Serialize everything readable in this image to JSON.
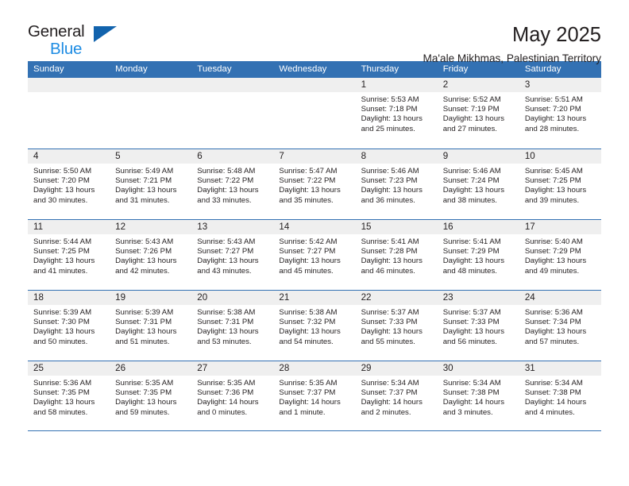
{
  "logo": {
    "word_top": "General",
    "word_bottom": "Blue",
    "triangle_color": "#1263ad",
    "blue_text_color": "#1e8ce3"
  },
  "header": {
    "title": "May 2025",
    "subtitle": "Ma'ale Mikhmas, Palestinian Territory"
  },
  "theme": {
    "accent": "#3371b3",
    "daynum_band": "#efefef",
    "text": "#231f20"
  },
  "weekdays": [
    "Sunday",
    "Monday",
    "Tuesday",
    "Wednesday",
    "Thursday",
    "Friday",
    "Saturday"
  ],
  "weeks": [
    [
      {
        "date": "",
        "sunrise": "",
        "sunset": "",
        "daylight": ""
      },
      {
        "date": "",
        "sunrise": "",
        "sunset": "",
        "daylight": ""
      },
      {
        "date": "",
        "sunrise": "",
        "sunset": "",
        "daylight": ""
      },
      {
        "date": "",
        "sunrise": "",
        "sunset": "",
        "daylight": ""
      },
      {
        "date": "1",
        "sunrise": "Sunrise: 5:53 AM",
        "sunset": "Sunset: 7:18 PM",
        "daylight": "Daylight: 13 hours and 25 minutes."
      },
      {
        "date": "2",
        "sunrise": "Sunrise: 5:52 AM",
        "sunset": "Sunset: 7:19 PM",
        "daylight": "Daylight: 13 hours and 27 minutes."
      },
      {
        "date": "3",
        "sunrise": "Sunrise: 5:51 AM",
        "sunset": "Sunset: 7:20 PM",
        "daylight": "Daylight: 13 hours and 28 minutes."
      }
    ],
    [
      {
        "date": "4",
        "sunrise": "Sunrise: 5:50 AM",
        "sunset": "Sunset: 7:20 PM",
        "daylight": "Daylight: 13 hours and 30 minutes."
      },
      {
        "date": "5",
        "sunrise": "Sunrise: 5:49 AM",
        "sunset": "Sunset: 7:21 PM",
        "daylight": "Daylight: 13 hours and 31 minutes."
      },
      {
        "date": "6",
        "sunrise": "Sunrise: 5:48 AM",
        "sunset": "Sunset: 7:22 PM",
        "daylight": "Daylight: 13 hours and 33 minutes."
      },
      {
        "date": "7",
        "sunrise": "Sunrise: 5:47 AM",
        "sunset": "Sunset: 7:22 PM",
        "daylight": "Daylight: 13 hours and 35 minutes."
      },
      {
        "date": "8",
        "sunrise": "Sunrise: 5:46 AM",
        "sunset": "Sunset: 7:23 PM",
        "daylight": "Daylight: 13 hours and 36 minutes."
      },
      {
        "date": "9",
        "sunrise": "Sunrise: 5:46 AM",
        "sunset": "Sunset: 7:24 PM",
        "daylight": "Daylight: 13 hours and 38 minutes."
      },
      {
        "date": "10",
        "sunrise": "Sunrise: 5:45 AM",
        "sunset": "Sunset: 7:25 PM",
        "daylight": "Daylight: 13 hours and 39 minutes."
      }
    ],
    [
      {
        "date": "11",
        "sunrise": "Sunrise: 5:44 AM",
        "sunset": "Sunset: 7:25 PM",
        "daylight": "Daylight: 13 hours and 41 minutes."
      },
      {
        "date": "12",
        "sunrise": "Sunrise: 5:43 AM",
        "sunset": "Sunset: 7:26 PM",
        "daylight": "Daylight: 13 hours and 42 minutes."
      },
      {
        "date": "13",
        "sunrise": "Sunrise: 5:43 AM",
        "sunset": "Sunset: 7:27 PM",
        "daylight": "Daylight: 13 hours and 43 minutes."
      },
      {
        "date": "14",
        "sunrise": "Sunrise: 5:42 AM",
        "sunset": "Sunset: 7:27 PM",
        "daylight": "Daylight: 13 hours and 45 minutes."
      },
      {
        "date": "15",
        "sunrise": "Sunrise: 5:41 AM",
        "sunset": "Sunset: 7:28 PM",
        "daylight": "Daylight: 13 hours and 46 minutes."
      },
      {
        "date": "16",
        "sunrise": "Sunrise: 5:41 AM",
        "sunset": "Sunset: 7:29 PM",
        "daylight": "Daylight: 13 hours and 48 minutes."
      },
      {
        "date": "17",
        "sunrise": "Sunrise: 5:40 AM",
        "sunset": "Sunset: 7:29 PM",
        "daylight": "Daylight: 13 hours and 49 minutes."
      }
    ],
    [
      {
        "date": "18",
        "sunrise": "Sunrise: 5:39 AM",
        "sunset": "Sunset: 7:30 PM",
        "daylight": "Daylight: 13 hours and 50 minutes."
      },
      {
        "date": "19",
        "sunrise": "Sunrise: 5:39 AM",
        "sunset": "Sunset: 7:31 PM",
        "daylight": "Daylight: 13 hours and 51 minutes."
      },
      {
        "date": "20",
        "sunrise": "Sunrise: 5:38 AM",
        "sunset": "Sunset: 7:31 PM",
        "daylight": "Daylight: 13 hours and 53 minutes."
      },
      {
        "date": "21",
        "sunrise": "Sunrise: 5:38 AM",
        "sunset": "Sunset: 7:32 PM",
        "daylight": "Daylight: 13 hours and 54 minutes."
      },
      {
        "date": "22",
        "sunrise": "Sunrise: 5:37 AM",
        "sunset": "Sunset: 7:33 PM",
        "daylight": "Daylight: 13 hours and 55 minutes."
      },
      {
        "date": "23",
        "sunrise": "Sunrise: 5:37 AM",
        "sunset": "Sunset: 7:33 PM",
        "daylight": "Daylight: 13 hours and 56 minutes."
      },
      {
        "date": "24",
        "sunrise": "Sunrise: 5:36 AM",
        "sunset": "Sunset: 7:34 PM",
        "daylight": "Daylight: 13 hours and 57 minutes."
      }
    ],
    [
      {
        "date": "25",
        "sunrise": "Sunrise: 5:36 AM",
        "sunset": "Sunset: 7:35 PM",
        "daylight": "Daylight: 13 hours and 58 minutes."
      },
      {
        "date": "26",
        "sunrise": "Sunrise: 5:35 AM",
        "sunset": "Sunset: 7:35 PM",
        "daylight": "Daylight: 13 hours and 59 minutes."
      },
      {
        "date": "27",
        "sunrise": "Sunrise: 5:35 AM",
        "sunset": "Sunset: 7:36 PM",
        "daylight": "Daylight: 14 hours and 0 minutes."
      },
      {
        "date": "28",
        "sunrise": "Sunrise: 5:35 AM",
        "sunset": "Sunset: 7:37 PM",
        "daylight": "Daylight: 14 hours and 1 minute."
      },
      {
        "date": "29",
        "sunrise": "Sunrise: 5:34 AM",
        "sunset": "Sunset: 7:37 PM",
        "daylight": "Daylight: 14 hours and 2 minutes."
      },
      {
        "date": "30",
        "sunrise": "Sunrise: 5:34 AM",
        "sunset": "Sunset: 7:38 PM",
        "daylight": "Daylight: 14 hours and 3 minutes."
      },
      {
        "date": "31",
        "sunrise": "Sunrise: 5:34 AM",
        "sunset": "Sunset: 7:38 PM",
        "daylight": "Daylight: 14 hours and 4 minutes."
      }
    ]
  ]
}
